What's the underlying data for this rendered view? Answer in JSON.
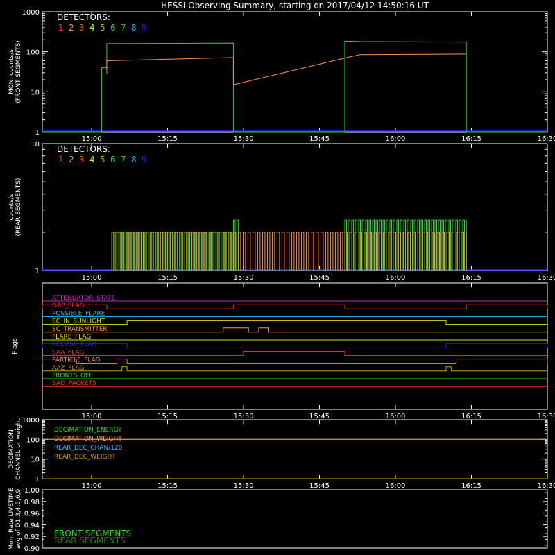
{
  "title": "HESSI Observing Summary, starting on 2017/04/12 14:50:16 UT",
  "colors": {
    "background": "#000000",
    "axes": "#ffffff",
    "det1": "#ff3030",
    "det2": "#ff9050",
    "det3": "#ff6a00",
    "det4": "#e0e000",
    "det5": "#c8a000",
    "det6": "#20e020",
    "det7": "#20c040",
    "det8": "#20c0ff",
    "det9": "#2020ff"
  },
  "time_ticks": [
    "15:00",
    "15:15",
    "15:30",
    "15:45",
    "16:00",
    "16:15",
    "16:30"
  ],
  "detectors": {
    "label": "DETECTORS:",
    "numbers": [
      "1",
      "2",
      "3",
      "4",
      "5",
      "6",
      "7",
      "8",
      "9"
    ]
  },
  "chart_data": [
    {
      "type": "line",
      "ylabel": "MON. counts/s\n(FRONT SEGMENTS)",
      "yscale": "log",
      "ylim": [
        1,
        1000
      ],
      "yticks": [
        "1",
        "10",
        "100",
        "1000"
      ],
      "xlim": [
        "14:50:16",
        "16:30"
      ],
      "grid": false,
      "series": [
        {
          "name": "6",
          "points": [
            [
              "14:50:16",
              1
            ],
            [
              "15:02",
              1
            ],
            [
              "15:02",
              40
            ],
            [
              "15:03",
              40
            ],
            [
              "15:03",
              160
            ],
            [
              "15:28",
              165
            ],
            [
              "15:28",
              1
            ],
            [
              "15:50",
              1
            ],
            [
              "15:50",
              185
            ],
            [
              "15:53",
              180
            ],
            [
              "16:14",
              175
            ],
            [
              "16:14",
              1
            ],
            [
              "16:30",
              1
            ]
          ]
        },
        {
          "name": "2",
          "points": [
            [
              "15:03",
              28
            ],
            [
              "15:03",
              60
            ],
            [
              "15:28",
              72
            ],
            [
              "15:28",
              15
            ],
            [
              "15:50",
              70
            ],
            [
              "15:53",
              85
            ],
            [
              "16:14",
              88
            ]
          ]
        }
      ]
    },
    {
      "type": "line",
      "ylabel": "counts/s\n(REAR SEGMENTS)",
      "yscale": "log",
      "ylim": [
        1,
        10
      ],
      "yticks": [
        "1",
        "10"
      ],
      "xlim": [
        "14:50:16",
        "16:30"
      ],
      "grid": false,
      "series": [
        {
          "name": "6",
          "points": [
            [
              "15:04",
              1
            ],
            [
              "15:04",
              2
            ],
            [
              "15:28",
              2
            ],
            [
              "15:28",
              2.5
            ],
            [
              "15:29",
              1
            ],
            [
              "15:50",
              1
            ],
            [
              "15:50",
              2.5
            ],
            [
              "16:14",
              2.5
            ],
            [
              "16:14",
              1
            ]
          ]
        },
        {
          "name": "2",
          "points": [
            [
              "15:04",
              1
            ],
            [
              "15:28",
              2
            ],
            [
              "15:50",
              2
            ],
            [
              "16:14",
              2
            ]
          ]
        }
      ]
    },
    {
      "type": "line",
      "ylabel": "Flags",
      "xlim": [
        "14:50:16",
        "16:30"
      ],
      "series": [
        {
          "name": "ATTENUATOR_STATE",
          "color": "#d020d0",
          "on_intervals": []
        },
        {
          "name": "GAP_FLAG",
          "color": "#ff3030",
          "on_intervals": [
            [
              "14:50:16",
              "15:03"
            ],
            [
              "15:28",
              "15:50"
            ],
            [
              "16:14",
              "16:30"
            ]
          ]
        },
        {
          "name": "POSSIBLE_FLARE",
          "color": "#20c0ff",
          "on_intervals": []
        },
        {
          "name": "SC_IN_SUNLIGHT",
          "color": "#e0e000",
          "on_intervals": [
            [
              "15:07",
              "16:10"
            ]
          ]
        },
        {
          "name": "SC_TRANSMITTER",
          "color": "#ff9050",
          "on_intervals": [
            [
              "15:26",
              "15:31"
            ],
            [
              "15:33",
              "15:35"
            ]
          ]
        },
        {
          "name": "FLARE_FLAG",
          "color": "#e0e000",
          "on_intervals": []
        },
        {
          "name": "ECLIPSE_FLAG",
          "color": "#2020ff",
          "on_intervals": [
            [
              "14:50:16",
              "15:07"
            ],
            [
              "16:10",
              "16:30"
            ]
          ]
        },
        {
          "name": "SAA_FLAG",
          "color": "#ff3030",
          "on_intervals": [
            [
              "15:30",
              "15:50"
            ]
          ]
        },
        {
          "name": "PARTICLE_FLAG",
          "color": "#ff9020",
          "on_intervals": [
            [
              "14:50:16",
              "14:57"
            ],
            [
              "15:05",
              "15:07"
            ],
            [
              "16:12",
              "16:30"
            ]
          ]
        },
        {
          "name": "AAZ_FLAG",
          "color": "#c8a000",
          "on_intervals": [
            [
              "15:06",
              "15:07"
            ],
            [
              "16:10",
              "16:11"
            ]
          ]
        },
        {
          "name": "FRONTS_OFF",
          "color": "#20e020",
          "on_intervals": []
        },
        {
          "name": "BAD_PACKETS",
          "color": "#ff3030",
          "on_intervals": []
        }
      ]
    },
    {
      "type": "line",
      "ylabel": "DECIMATION\nCHANNEL or weight",
      "yscale": "log",
      "ylim": [
        1,
        1000
      ],
      "yticks": [
        "1",
        "10",
        "100",
        "1000"
      ],
      "xlim": [
        "14:50:16",
        "16:30"
      ],
      "series": [
        {
          "name": "DECIMATION_ENERGY",
          "color": "#20e020",
          "points": [
            [
              "14:50:16",
              100
            ],
            [
              "16:30",
              100
            ]
          ]
        },
        {
          "name": "DECIMATION_WEIGHT",
          "color": "#ff9050",
          "points": [
            [
              "14:50:16",
              100
            ],
            [
              "16:30",
              100
            ]
          ]
        },
        {
          "name": "REAR_DEC_CHAN/128",
          "color": "#20c0ff",
          "points": [
            [
              "14:50:16",
              1
            ],
            [
              "16:30",
              1
            ]
          ]
        },
        {
          "name": "REAR_DEC_WEIGHT",
          "color": "#c8a000",
          "points": [
            [
              "14:50:16",
              1
            ],
            [
              "16:30",
              1
            ]
          ]
        }
      ]
    },
    {
      "type": "line",
      "ylabel": "Mon. Rate LIVETIME\navg of D1,3,4,5,6,9",
      "ylim": [
        0.9,
        1.0
      ],
      "yticks": [
        "0.90",
        "0.92",
        "0.94",
        "0.96",
        "0.98",
        "1.00"
      ],
      "xlim": [
        "14:50:16",
        "16:30"
      ],
      "series": [
        {
          "name": "FRONT SEGMENTS",
          "color": "#20e020",
          "points": []
        },
        {
          "name": "REAR SEGMENTS",
          "color": "#208020",
          "points": []
        }
      ]
    }
  ]
}
